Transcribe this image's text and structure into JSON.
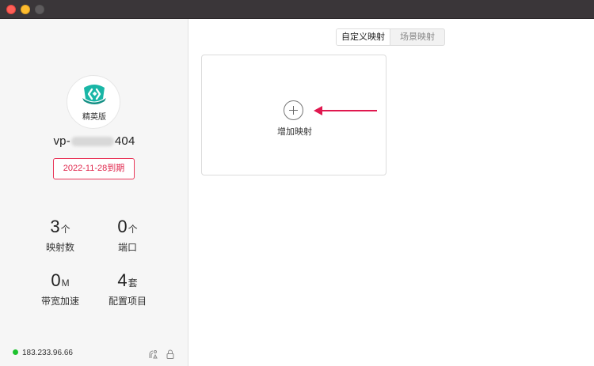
{
  "window": {
    "controls": [
      "close",
      "minimize",
      "maximize"
    ]
  },
  "sidebar": {
    "logo_icon": "app-logo-icon",
    "edition": "精英版",
    "username_prefix": "vp-",
    "username_suffix": "404",
    "expiry": "2022-11-28到期",
    "stats": [
      {
        "value": "3",
        "unit": "个",
        "label": "映射数"
      },
      {
        "value": "0",
        "unit": "个",
        "label": "端口"
      },
      {
        "value": "0",
        "unit": "M",
        "label": "带宽加速"
      },
      {
        "value": "4",
        "unit": "套",
        "label": "配置项目"
      }
    ],
    "ip": "183.233.96.66",
    "status_color": "#1ec22f",
    "footer_icons": [
      "network-icon",
      "lock-icon"
    ]
  },
  "main": {
    "tabs": [
      {
        "label": "自定义映射",
        "active": true
      },
      {
        "label": "场景映射",
        "active": false
      }
    ],
    "add_card": {
      "label": "增加映射",
      "icon": "plus-circle-icon"
    },
    "annotation_arrow_color": "#e0184f"
  },
  "colors": {
    "accent_red": "#e0264c",
    "logo_teal": "#19b6a6"
  }
}
